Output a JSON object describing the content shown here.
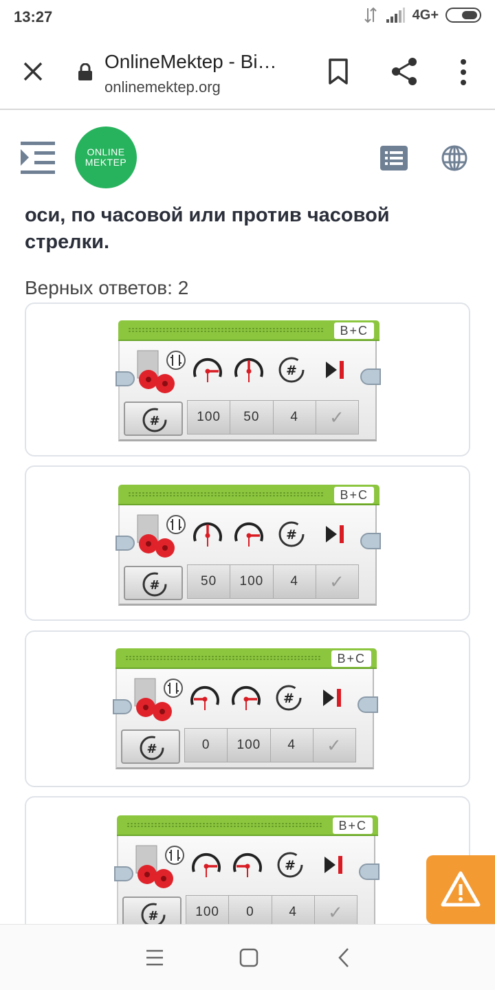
{
  "status_bar": {
    "time": "13:27",
    "network": "4G+"
  },
  "browser": {
    "title": "OnlineMektep - Bi…",
    "url": "onlinemektep.org"
  },
  "logo": {
    "line1": "ONLINE",
    "line2": "MEKTEP"
  },
  "question": {
    "text": "оси, по часовой или против часовой стрелки.",
    "answers_count": "Верных ответов: 2"
  },
  "options": [
    {
      "ports": "B+C",
      "values": [
        "100",
        "50",
        "4"
      ]
    },
    {
      "ports": "B+C",
      "values": [
        "50",
        "100",
        "4"
      ]
    },
    {
      "ports": "B+C",
      "values": [
        "0",
        "100",
        "4"
      ]
    },
    {
      "ports": "B+C",
      "values": [
        "100",
        "0",
        "4"
      ]
    }
  ],
  "colors": {
    "logo_green": "#27b35d",
    "block_green": "#8cc63f",
    "report_orange": "#f39a33",
    "motor_red": "#e0232b"
  },
  "icons": [
    "close-icon",
    "lock-icon",
    "bookmark-icon",
    "share-icon",
    "more-vert-icon",
    "table-of-contents-icon",
    "list-icon",
    "globe-icon",
    "warning-icon",
    "nav-menu-icon",
    "nav-home-icon",
    "nav-back-icon"
  ]
}
